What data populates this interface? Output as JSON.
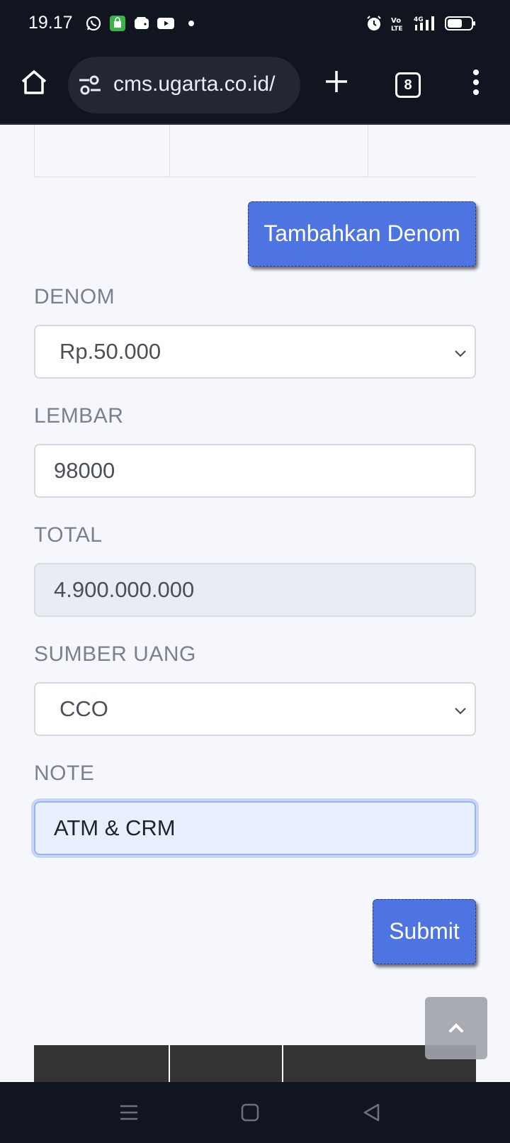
{
  "status_bar": {
    "time": "19.17",
    "icons_left": [
      "whatsapp-icon",
      "shopping-bag-icon",
      "wallet-icon",
      "youtube-icon"
    ],
    "icons_right": [
      "alarm-icon",
      "volte-icon",
      "signal-4g-icon",
      "battery-icon"
    ]
  },
  "browser": {
    "url": "cms.ugarta.co.id/",
    "tab_count": "8"
  },
  "form": {
    "add_denom_label": "Tambahkan Denom",
    "denom_label": "DENOM",
    "denom_value": "Rp.50.000",
    "lembar_label": "LEMBAR",
    "lembar_value": "98000",
    "total_label": "TOTAL",
    "total_value": "4.900.000.000",
    "sumber_label": "SUMBER UANG",
    "sumber_value": "CCO",
    "note_label": "NOTE",
    "note_value": "ATM & CRM",
    "submit_label": "Submit"
  },
  "colors": {
    "accent": "#4d74e1",
    "chrome_dark": "#111520",
    "page_bg": "#f5f7fc"
  }
}
